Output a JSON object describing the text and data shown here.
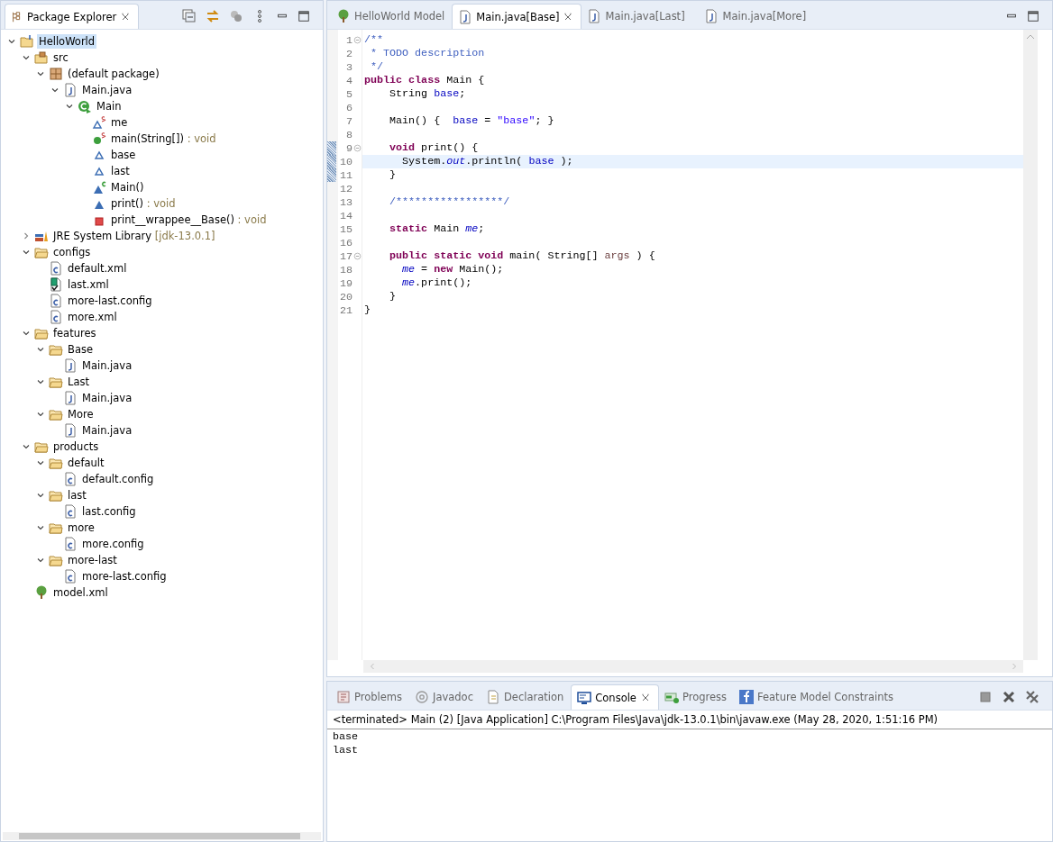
{
  "package_explorer": {
    "title": "Package Explorer",
    "tree": [
      {
        "label": "HelloWorld",
        "kind": "project",
        "expanded": true,
        "selected": true,
        "children": [
          {
            "label": "src",
            "kind": "src-folder",
            "expanded": true,
            "selected": false,
            "children": [
              {
                "label": "(default package)",
                "kind": "package",
                "expanded": true,
                "selected": false,
                "children": [
                  {
                    "label": "Main.java",
                    "kind": "java-file",
                    "expanded": true,
                    "selected": false,
                    "children": [
                      {
                        "label": "Main",
                        "kind": "class",
                        "expanded": true,
                        "selected": false,
                        "children": [
                          {
                            "label": "me",
                            "kind": "static-field",
                            "selected": false
                          },
                          {
                            "label": "main(String[])",
                            "detail": ": void",
                            "kind": "static-method",
                            "selected": false
                          },
                          {
                            "label": "base",
                            "kind": "field",
                            "selected": false
                          },
                          {
                            "label": "last",
                            "kind": "field",
                            "selected": false
                          },
                          {
                            "label": "Main()",
                            "kind": "constructor",
                            "selected": false
                          },
                          {
                            "label": "print()",
                            "detail": ": void",
                            "kind": "method",
                            "selected": false
                          },
                          {
                            "label": "print__wrappee__Base()",
                            "detail": ": void",
                            "kind": "private-method",
                            "selected": false
                          }
                        ]
                      }
                    ]
                  }
                ]
              }
            ]
          },
          {
            "label": "JRE System Library",
            "detail": "[jdk-13.0.1]",
            "kind": "library",
            "expanded": false,
            "selected": false
          },
          {
            "label": "configs",
            "kind": "folder",
            "expanded": true,
            "selected": false,
            "children": [
              {
                "label": "default.xml",
                "kind": "config",
                "selected": false
              },
              {
                "label": "last.xml",
                "kind": "config-checked",
                "selected": false
              },
              {
                "label": "more-last.config",
                "kind": "config",
                "selected": false
              },
              {
                "label": "more.xml",
                "kind": "config",
                "selected": false
              }
            ]
          },
          {
            "label": "features",
            "kind": "folder",
            "expanded": true,
            "selected": false,
            "children": [
              {
                "label": "Base",
                "kind": "folder",
                "expanded": true,
                "selected": false,
                "children": [
                  {
                    "label": "Main.java",
                    "kind": "java-file",
                    "selected": false
                  }
                ]
              },
              {
                "label": "Last",
                "kind": "folder",
                "expanded": true,
                "selected": false,
                "children": [
                  {
                    "label": "Main.java",
                    "kind": "java-file",
                    "selected": false
                  }
                ]
              },
              {
                "label": "More",
                "kind": "folder",
                "expanded": true,
                "selected": false,
                "children": [
                  {
                    "label": "Main.java",
                    "kind": "java-file",
                    "selected": false
                  }
                ]
              }
            ]
          },
          {
            "label": "products",
            "kind": "folder",
            "expanded": true,
            "selected": false,
            "children": [
              {
                "label": "default",
                "kind": "folder",
                "expanded": true,
                "selected": false,
                "children": [
                  {
                    "label": "default.config",
                    "kind": "config",
                    "selected": false
                  }
                ]
              },
              {
                "label": "last",
                "kind": "folder",
                "expanded": true,
                "selected": false,
                "children": [
                  {
                    "label": "last.config",
                    "kind": "config",
                    "selected": false
                  }
                ]
              },
              {
                "label": "more",
                "kind": "folder",
                "expanded": true,
                "selected": false,
                "children": [
                  {
                    "label": "more.config",
                    "kind": "config",
                    "selected": false
                  }
                ]
              },
              {
                "label": "more-last",
                "kind": "folder",
                "expanded": true,
                "selected": false,
                "children": [
                  {
                    "label": "more-last.config",
                    "kind": "config",
                    "selected": false
                  }
                ]
              }
            ]
          },
          {
            "label": "model.xml",
            "kind": "model",
            "selected": false
          }
        ]
      }
    ]
  },
  "editor": {
    "tabs": [
      {
        "label": "HelloWorld Model",
        "kind": "model",
        "selected": false
      },
      {
        "label": "Main.java[Base]",
        "kind": "java-file",
        "selected": true
      },
      {
        "label": "Main.java[Last]",
        "kind": "java-file",
        "selected": false
      },
      {
        "label": "Main.java[More]",
        "kind": "java-file",
        "selected": false
      }
    ],
    "lines": [
      {
        "number": "1",
        "fold": true,
        "current": false,
        "changed": false,
        "tokens": [
          {
            "kind": "doc",
            "text": "/**"
          }
        ]
      },
      {
        "number": "2",
        "fold": false,
        "current": false,
        "changed": false,
        "tokens": [
          {
            "kind": "doc",
            "text": " * TODO description"
          }
        ]
      },
      {
        "number": "3",
        "fold": false,
        "current": false,
        "changed": false,
        "tokens": [
          {
            "kind": "doc",
            "text": " */"
          }
        ]
      },
      {
        "number": "4",
        "fold": false,
        "current": false,
        "changed": false,
        "tokens": [
          {
            "kind": "keyword",
            "text": "public class"
          },
          {
            "kind": "plain",
            "text": " Main {"
          }
        ]
      },
      {
        "number": "5",
        "fold": false,
        "current": false,
        "changed": false,
        "tokens": [
          {
            "kind": "plain",
            "text": "    String "
          },
          {
            "kind": "field",
            "text": "base"
          },
          {
            "kind": "plain",
            "text": ";"
          }
        ]
      },
      {
        "number": "6",
        "fold": false,
        "current": false,
        "changed": false
      },
      {
        "number": "7",
        "fold": false,
        "current": false,
        "changed": false,
        "tokens": [
          {
            "kind": "plain",
            "text": "    Main() {  "
          },
          {
            "kind": "field",
            "text": "base"
          },
          {
            "kind": "plain",
            "text": " = "
          },
          {
            "kind": "string",
            "text": "\"base\""
          },
          {
            "kind": "plain",
            "text": "; }"
          }
        ]
      },
      {
        "number": "8",
        "fold": false,
        "current": false,
        "changed": false
      },
      {
        "number": "9",
        "fold": true,
        "current": false,
        "changed": true,
        "tokens": [
          {
            "kind": "keyword",
            "text": "    void"
          },
          {
            "kind": "plain",
            "text": " print() {"
          }
        ]
      },
      {
        "number": "10",
        "fold": false,
        "current": true,
        "changed": true,
        "tokens": [
          {
            "kind": "plain",
            "text": "      System."
          },
          {
            "kind": "static-field",
            "text": "out"
          },
          {
            "kind": "plain",
            "text": ".println( "
          },
          {
            "kind": "field",
            "text": "base"
          },
          {
            "kind": "plain",
            "text": " );"
          }
        ]
      },
      {
        "number": "11",
        "fold": false,
        "current": false,
        "changed": true,
        "tokens": [
          {
            "kind": "plain",
            "text": "    }"
          }
        ]
      },
      {
        "number": "12",
        "fold": false,
        "current": false,
        "changed": false
      },
      {
        "number": "13",
        "fold": false,
        "current": false,
        "changed": false,
        "tokens": [
          {
            "kind": "doc",
            "text": "    /*****************/"
          }
        ]
      },
      {
        "number": "14",
        "fold": false,
        "current": false,
        "changed": false
      },
      {
        "number": "15",
        "fold": false,
        "current": false,
        "changed": false,
        "tokens": [
          {
            "kind": "keyword",
            "text": "    static"
          },
          {
            "kind": "plain",
            "text": " Main "
          },
          {
            "kind": "static-field",
            "text": "me"
          },
          {
            "kind": "plain",
            "text": ";"
          }
        ]
      },
      {
        "number": "16",
        "fold": false,
        "current": false,
        "changed": false
      },
      {
        "number": "17",
        "fold": true,
        "current": false,
        "changed": false,
        "tokens": [
          {
            "kind": "keyword",
            "text": "    public static void"
          },
          {
            "kind": "plain",
            "text": " main( String[] "
          },
          {
            "kind": "param",
            "text": "args"
          },
          {
            "kind": "plain",
            "text": " ) {"
          }
        ]
      },
      {
        "number": "18",
        "fold": false,
        "current": false,
        "changed": false,
        "tokens": [
          {
            "kind": "static-field",
            "text": "      me"
          },
          {
            "kind": "plain",
            "text": " = "
          },
          {
            "kind": "keyword",
            "text": "new"
          },
          {
            "kind": "plain",
            "text": " Main();"
          }
        ]
      },
      {
        "number": "19",
        "fold": false,
        "current": false,
        "changed": false,
        "tokens": [
          {
            "kind": "static-field",
            "text": "      me"
          },
          {
            "kind": "plain",
            "text": ".print();"
          }
        ]
      },
      {
        "number": "20",
        "fold": false,
        "current": false,
        "changed": false,
        "tokens": [
          {
            "kind": "plain",
            "text": "    }"
          }
        ]
      },
      {
        "number": "21",
        "fold": false,
        "current": false,
        "changed": false,
        "tokens": [
          {
            "kind": "plain",
            "text": "}"
          }
        ]
      }
    ]
  },
  "console": {
    "tabs": [
      {
        "label": "Problems",
        "kind": "problems",
        "selected": false
      },
      {
        "label": "Javadoc",
        "kind": "javadoc",
        "selected": false
      },
      {
        "label": "Declaration",
        "kind": "declaration",
        "selected": false
      },
      {
        "label": "Console",
        "kind": "console",
        "selected": true
      },
      {
        "label": "Progress",
        "kind": "progress",
        "selected": false
      },
      {
        "label": "Feature Model Constraints",
        "kind": "constraints",
        "selected": false
      }
    ],
    "header": "<terminated> Main (2) [Java Application] C:\\Program Files\\Java\\jdk-13.0.1\\bin\\javaw.exe (May 28, 2020, 1:51:16 PM)",
    "output": [
      "base",
      "last"
    ]
  }
}
